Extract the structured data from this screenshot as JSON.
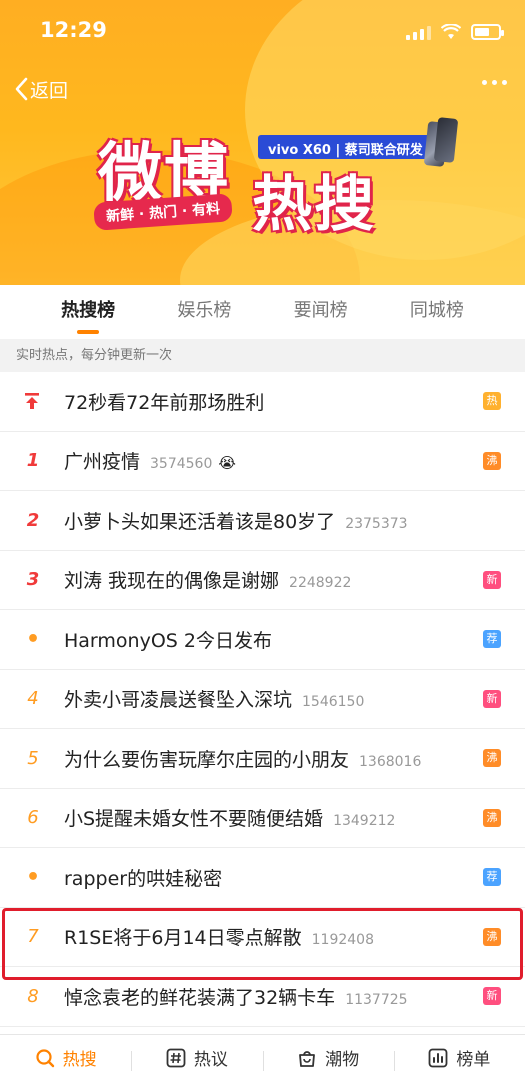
{
  "status": {
    "time": "12:29"
  },
  "header": {
    "back_label": "返回",
    "logo_text_1": "微博",
    "logo_text_2": "热搜",
    "logo_tagline": "新鲜 · 热门 · 有料",
    "sponsor": "vivo X60 | 蔡司联合研发"
  },
  "tabs": [
    {
      "label": "热搜榜",
      "active": true
    },
    {
      "label": "娱乐榜",
      "active": false
    },
    {
      "label": "要闻榜",
      "active": false
    },
    {
      "label": "同城榜",
      "active": false
    }
  ],
  "subhead": "实时热点，每分钟更新一次",
  "list": [
    {
      "rank": "",
      "rank_type": "pin",
      "title": "72秒看72年前那场胜利",
      "count": "",
      "badge": "热",
      "badge_type": "hot"
    },
    {
      "rank": "1",
      "rank_type": "top",
      "title": "广州疫情",
      "count": "3574560",
      "emoji": "😭",
      "badge": "沸",
      "badge_type": "boil"
    },
    {
      "rank": "2",
      "rank_type": "top",
      "title": "小萝卜头如果还活着该是80岁了",
      "count": "2375373",
      "badge": "",
      "badge_type": ""
    },
    {
      "rank": "3",
      "rank_type": "top",
      "title": "刘涛 我现在的偶像是谢娜",
      "count": "2248922",
      "badge": "新",
      "badge_type": "new"
    },
    {
      "rank": "•",
      "rank_type": "dot",
      "title": "HarmonyOS 2今日发布",
      "count": "",
      "badge": "荐",
      "badge_type": "rec"
    },
    {
      "rank": "4",
      "rank_type": "normal",
      "title": "外卖小哥凌晨送餐坠入深坑",
      "count": "1546150",
      "badge": "新",
      "badge_type": "new"
    },
    {
      "rank": "5",
      "rank_type": "normal",
      "title": "为什么要伤害玩摩尔庄园的小朋友",
      "count": "1368016",
      "badge": "沸",
      "badge_type": "boil"
    },
    {
      "rank": "6",
      "rank_type": "normal",
      "title": "小S提醒未婚女性不要随便结婚",
      "count": "1349212",
      "badge": "沸",
      "badge_type": "boil"
    },
    {
      "rank": "•",
      "rank_type": "dot",
      "title": "rapper的哄娃秘密",
      "count": "",
      "badge": "荐",
      "badge_type": "rec"
    },
    {
      "rank": "7",
      "rank_type": "normal",
      "title": "R1SE将于6月14日零点解散",
      "count": "1192408",
      "badge": "沸",
      "badge_type": "boil"
    },
    {
      "rank": "8",
      "rank_type": "normal",
      "title": "悼念袁老的鲜花装满了32辆卡车",
      "count": "1137725",
      "badge": "新",
      "badge_type": "new"
    }
  ],
  "bottom_nav": [
    {
      "label": "热搜",
      "icon": "search-icon",
      "active": true
    },
    {
      "label": "热议",
      "icon": "hash-icon",
      "active": false
    },
    {
      "label": "潮物",
      "icon": "bag-icon",
      "active": false
    },
    {
      "label": "榜单",
      "icon": "chart-icon",
      "active": false
    }
  ],
  "colors": {
    "accent": "#ff8200",
    "highlight": "#e01d2c"
  }
}
